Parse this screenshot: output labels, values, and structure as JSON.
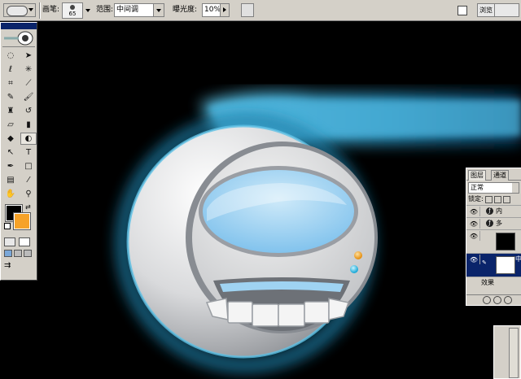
{
  "options_bar": {
    "brush_label": "画笔:",
    "brush_size": "65",
    "range_label": "范围:",
    "range_value": "中间调",
    "exposure_label": "曝光度:",
    "exposure_value": "10%",
    "browser_label": "浏览"
  },
  "toolbox": {
    "foreground_color": "#000000",
    "background_color": "#f6a228",
    "tools": [
      {
        "name": "marquee-tool-icon",
        "glyph": "◌"
      },
      {
        "name": "move-tool-icon",
        "glyph": "➤"
      },
      {
        "name": "lasso-tool-icon",
        "glyph": "ℓ"
      },
      {
        "name": "magic-wand-tool-icon",
        "glyph": "✳"
      },
      {
        "name": "crop-tool-icon",
        "glyph": "⌗"
      },
      {
        "name": "slice-tool-icon",
        "glyph": "⟋"
      },
      {
        "name": "healing-brush-tool-icon",
        "glyph": "✎"
      },
      {
        "name": "brush-tool-icon",
        "glyph": "🖌"
      },
      {
        "name": "clone-stamp-tool-icon",
        "glyph": "♜"
      },
      {
        "name": "history-brush-tool-icon",
        "glyph": "↺"
      },
      {
        "name": "eraser-tool-icon",
        "glyph": "▱"
      },
      {
        "name": "gradient-tool-icon",
        "glyph": "▮"
      },
      {
        "name": "blur-tool-icon",
        "glyph": "◆"
      },
      {
        "name": "dodge-tool-icon",
        "glyph": "◐"
      },
      {
        "name": "path-selection-tool-icon",
        "glyph": "↖"
      },
      {
        "name": "type-tool-icon",
        "glyph": "T"
      },
      {
        "name": "pen-tool-icon",
        "glyph": "✒"
      },
      {
        "name": "shape-tool-icon",
        "glyph": "□"
      },
      {
        "name": "notes-tool-icon",
        "glyph": "▤"
      },
      {
        "name": "eyedropper-tool-icon",
        "glyph": "⁄"
      },
      {
        "name": "hand-tool-icon",
        "glyph": "✋"
      },
      {
        "name": "zoom-tool-icon",
        "glyph": "⚲"
      }
    ]
  },
  "layers_panel": {
    "tab_layers": "图层",
    "tab_channels": "通道",
    "blend_mode": "正常",
    "lock_label": "锁定:",
    "rows": [
      {
        "label": "内"
      },
      {
        "label": "多"
      },
      {
        "label": ""
      },
      {
        "label": "中"
      },
      {
        "label": "效果"
      }
    ]
  },
  "colors": {
    "ui_gray": "#d4d0c8",
    "selection_blue": "#0a246a",
    "glow_cyan": "#1d8fb8",
    "screen_blue": "#a9d6f4"
  }
}
